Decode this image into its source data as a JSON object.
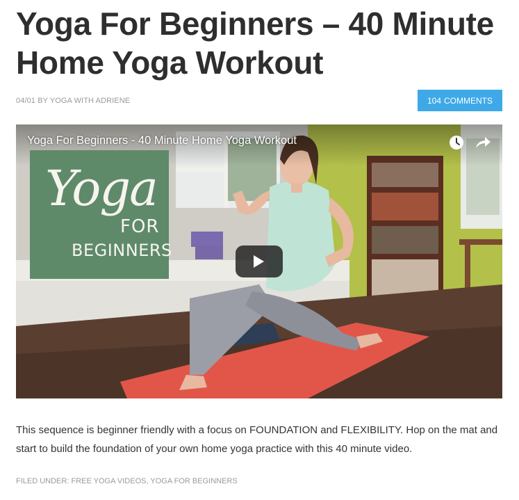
{
  "post": {
    "title": "Yoga For Beginners – 40 Minute Home Yoga Workout",
    "date": "04/01",
    "by_label": "BY",
    "author": "YOGA WITH ADRIENE",
    "comments_count": "104",
    "comments_label": "COMMENTS"
  },
  "video": {
    "title": "Yoga For Beginners - 40 Minute Home Yoga Workout",
    "thumbnail_card": {
      "script_word": "Yoga",
      "for_word": "FOR",
      "beginners_word": "BEGINNERS"
    },
    "icons": {
      "watch_later": "clock-icon",
      "share": "share-arrow-icon",
      "play": "play-icon"
    }
  },
  "description": "This sequence is beginner friendly with a focus on FOUNDATION and FLEXIBILITY. Hop on the mat and start to build the foundation of your own home yoga practice with this 40 minute video.",
  "footer": {
    "filed_label": "FILED UNDER:",
    "categories": [
      "FREE YOGA VIDEOS",
      "YOGA FOR BEGINNERS"
    ],
    "separator": ","
  },
  "colors": {
    "title_text": "#2e2e2e",
    "meta_text": "#9a9a9a",
    "comments_button": "#3fa9e8",
    "yoga_card": "#5e8a6a",
    "mat": "#e2564a"
  }
}
